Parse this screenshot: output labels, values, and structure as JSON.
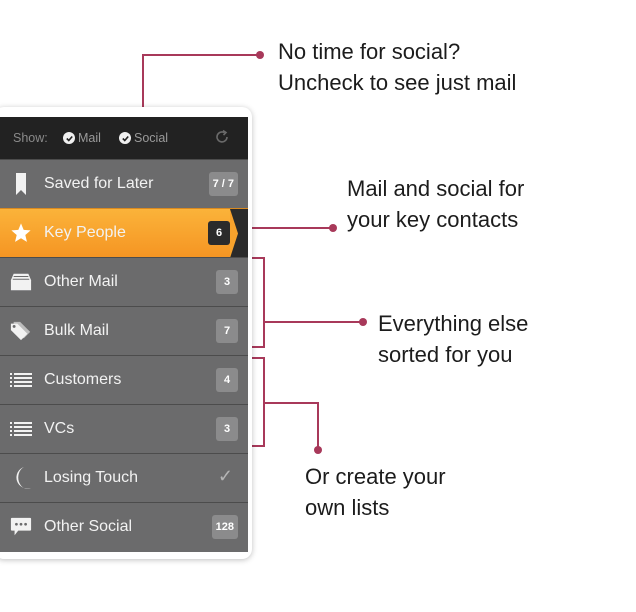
{
  "header": {
    "show_label": "Show:",
    "options": [
      {
        "label": "Mail",
        "checked": true
      },
      {
        "label": "Social",
        "checked": true
      }
    ],
    "refresh_icon": "refresh-icon"
  },
  "lists": [
    {
      "label": "Saved for Later",
      "icon": "bookmark-icon",
      "badge": "7 / 7",
      "active": false
    },
    {
      "label": "Key People",
      "icon": "star-icon",
      "badge": "6",
      "active": true
    },
    {
      "label": "Other Mail",
      "icon": "inbox-tray-icon",
      "badge": "3",
      "active": false
    },
    {
      "label": "Bulk Mail",
      "icon": "tag-icon",
      "badge": "7",
      "active": false
    },
    {
      "label": "Customers",
      "icon": "list-icon",
      "badge": "4",
      "active": false
    },
    {
      "label": "VCs",
      "icon": "list-icon",
      "badge": "3",
      "active": false
    },
    {
      "label": "Losing Touch",
      "icon": "moon-icon",
      "badge": "✓",
      "active": false
    },
    {
      "label": "Other Social",
      "icon": "chat-bubble-icon",
      "badge": "128",
      "active": false
    }
  ],
  "callouts": {
    "social": [
      "No time for social?",
      "Uncheck to see just mail"
    ],
    "key": [
      "Mail and social for",
      "your key contacts"
    ],
    "sorted": [
      "Everything else",
      "sorted for you"
    ],
    "lists": [
      "Or create your",
      "own lists"
    ]
  },
  "colors": {
    "accent": "#a8395a",
    "active_row": "#f7a22c",
    "row": "#6b6b6c",
    "header": "#222222"
  }
}
